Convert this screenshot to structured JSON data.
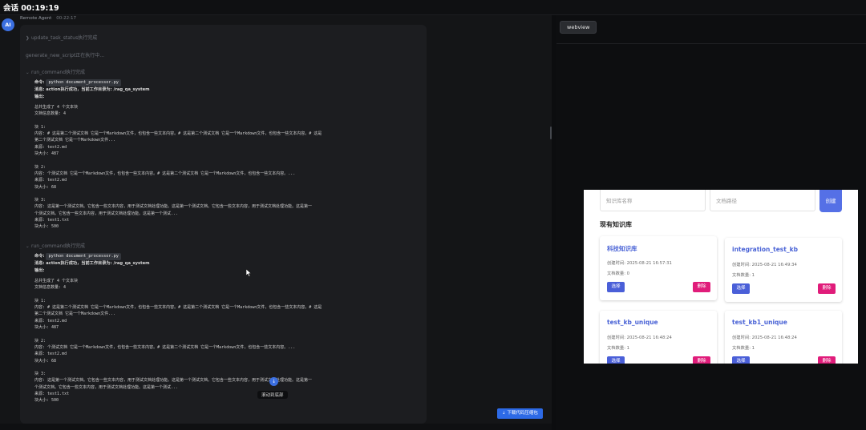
{
  "header": {
    "session_title": "会话 00:19:19"
  },
  "chat": {
    "avatar_label": "AI",
    "sender_name": "Remote Agent",
    "sender_time": "00:22:17",
    "steps": {
      "update_status": "update_task_status执行完成",
      "generate_script": "generate_new_script正在执行中...",
      "run_command_1": "run_command执行完成",
      "run_command_2": "run_command执行完成"
    },
    "block1": {
      "cmd_label": "命令:",
      "cmd": "python document_processor.py",
      "msg": "消息: action执行成功，当前工作目录为: /rag_qa_system",
      "out_label": "输出:",
      "output": "总共生成了 4 个文本块\n文档信息数量: 4\n\n块 1:\n内容: # 这是第二个测试文档 它是一个Markdown文件，也包含一些文本内容。# 这是第二个测试文档 它是一个Markdown文件，也包含一些文本内容。# 这是\n第二个测试文档 它是一个Markdown文件...\n来源: test2.md\n块大小: 487\n\n块 2:\n内容: 个测试文档 它是一个Markdown文件，也包含一些文本内容。# 这是第二个测试文档 它是一个Markdown文件，也包含一些文本内容。...\n来源: test2.md\n块大小: 68\n\n块 3:\n内容: 这是第一个测试文档。它包含一些文本内容，用于测试文档处理功能。这是第一个测试文档。它包含一些文本内容，用于测试文档处理功能。这是第一\n个测试文档。它包含一些文本内容，用于测试文档处理功能。这是第一个测试...\n来源: test1.txt\n块大小: 500"
    },
    "block2": {
      "cmd_label": "命令:",
      "cmd": "python document_processor.py",
      "msg": "消息: action执行成功，当前工作目录为: /rag_qa_system",
      "out_label": "输出:",
      "output": "总共生成了 4 个文本块\n文档信息数量: 4\n\n块 1:\n内容: # 这是第二个测试文档 它是一个Markdown文件，也包含一些文本内容。# 这是第二个测试文档 它是一个Markdown文件，也包含一些文本内容。# 这是\n第二个测试文档 它是一个Markdown文件...\n来源: test2.md\n块大小: 487\n\n块 2:\n内容: 个测试文档 它是一个Markdown文件，也包含一些文本内容。# 这是第二个测试文档 它是一个Markdown文件，也包含一些文本内容。...\n来源: test2.md\n块大小: 68\n\n块 3:\n内容: 这是第一个测试文档。它包含一些文本内容，用于测试文档处理功能。这是第一个测试文档。它包含一些文本内容，用于测试文档处理功能。这是第一\n个测试文档。它包含一些文本内容，用于测试文档处理功能。这是第一个测试...\n来源: test1.txt\n块大小: 500"
    },
    "scroll_to_bottom": "滚动到底部",
    "download_button": "⇣ 下载代码压缩包"
  },
  "right_panel": {
    "tab_label": "webview",
    "webview": {
      "kb_name_placeholder": "知识库名称",
      "doc_path_placeholder": "文档路径",
      "create_button": "创建",
      "section_title": "现有知识库",
      "cards": [
        {
          "name": "科技知识库",
          "created": "创建时间: 2025-08-21 16:57:31",
          "docs": "文档数量: 0",
          "select": "选择",
          "delete": "删除"
        },
        {
          "name": "integration_test_kb",
          "created": "创建时间: 2025-08-21 16:49:34",
          "docs": "文档数量: 1",
          "select": "选择",
          "delete": "删除"
        },
        {
          "name": "test_kb_unique",
          "created": "创建时间: 2025-08-21 16:48:24",
          "docs": "文档数量: 1",
          "select": "选择",
          "delete": "删除"
        },
        {
          "name": "test_kb1_unique",
          "created": "创建时间: 2025-08-21 16:48:24",
          "docs": "文档数量: 1",
          "select": "选择",
          "delete": "删除"
        }
      ]
    }
  },
  "colors": {
    "accent": "#3b6fe0",
    "delete": "#e01c7a",
    "select": "#4a5fd8"
  }
}
